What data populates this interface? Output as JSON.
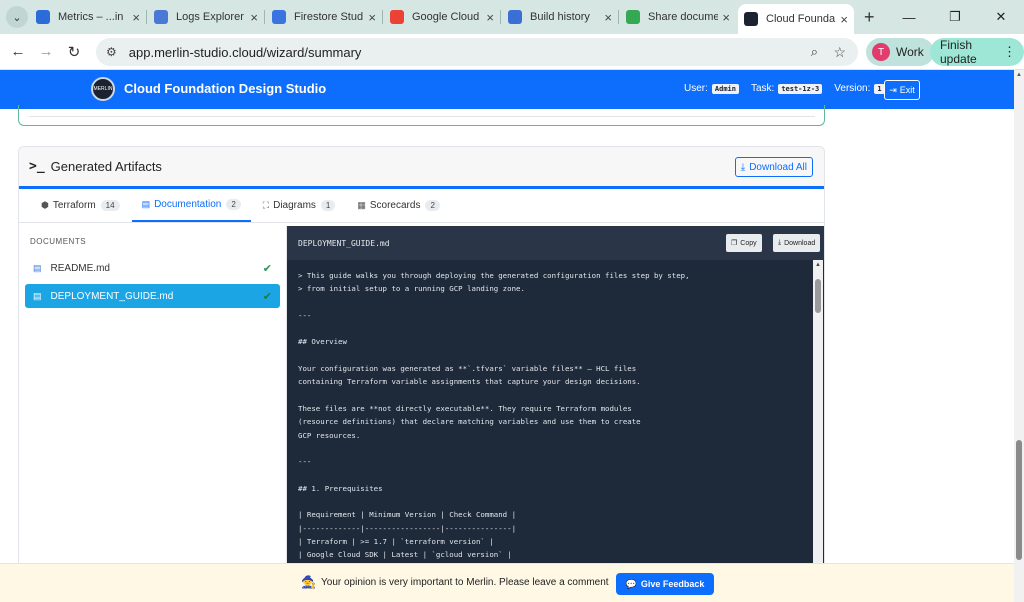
{
  "browser": {
    "tabs": [
      {
        "title": "Metrics – ...in",
        "icon": "chevron-icon",
        "color": "#2b6cd8"
      },
      {
        "title": "Logs Explorer",
        "icon": "list-icon",
        "color": "#4a78d6"
      },
      {
        "title": "Firestore Stud",
        "icon": "firestore-icon",
        "color": "#3a74e0"
      },
      {
        "title": "Google Cloud",
        "icon": "google-icon",
        "color": "#ea4335"
      },
      {
        "title": "Build history",
        "icon": "cloudbuild-icon",
        "color": "#3b6fd6"
      },
      {
        "title": "Share docume",
        "icon": "google-icon",
        "color": "#34a853"
      },
      {
        "title": "Cloud Founda",
        "icon": "merlin-icon",
        "color": "#1b2330"
      }
    ],
    "url": "app.merlin-studio.cloud/wizard/summary",
    "profile_initial": "T",
    "profile_label": "Work",
    "update_label": "Finish update"
  },
  "app": {
    "title": "Cloud Foundation Design Studio",
    "logo_text": "MERLIN",
    "user_label": "User:",
    "user_value": "Admin",
    "task_label": "Task:",
    "task_value": "test-1z-3",
    "version_label": "Version:",
    "version_value": "1",
    "exit_label": "Exit"
  },
  "artifacts": {
    "prompt": ">_",
    "title": "Generated Artifacts",
    "download_all": "Download All",
    "tabs": [
      {
        "label": "Terraform",
        "count": "14",
        "icon": "cube-icon"
      },
      {
        "label": "Documentation",
        "count": "2",
        "icon": "file-icon"
      },
      {
        "label": "Diagrams",
        "count": "1",
        "icon": "diagram-icon"
      },
      {
        "label": "Scorecards",
        "count": "2",
        "icon": "scorecard-icon"
      }
    ],
    "documents_header": "DOCUMENTS",
    "documents": [
      {
        "name": "README.md"
      },
      {
        "name": "DEPLOYMENT_GUIDE.md"
      }
    ],
    "viewer": {
      "filename": "DEPLOYMENT_GUIDE.md",
      "copy": "Copy",
      "download": "Download",
      "content": "> This guide walks you through deploying the generated configuration files step by step,\n> from initial setup to a running GCP landing zone.\n\n---\n\n## Overview\n\nYour configuration was generated as **`.tfvars` variable files** — HCL files\ncontaining Terraform variable assignments that capture your design decisions.\n\nThese files are **not directly executable**. They require Terraform modules\n(resource definitions) that declare matching variables and use them to create\nGCP resources.\n\n---\n\n## 1. Prerequisites\n\n| Requirement | Minimum Version | Check Command |\n|-------------|-----------------|---------------|\n| Terraform | >= 1.7 | `terraform version` |\n| Google Cloud SDK | Latest | `gcloud version` |"
    }
  },
  "feedback": {
    "text": "Your opinion is very important to Merlin. Please leave a comment",
    "button": "Give Feedback"
  }
}
